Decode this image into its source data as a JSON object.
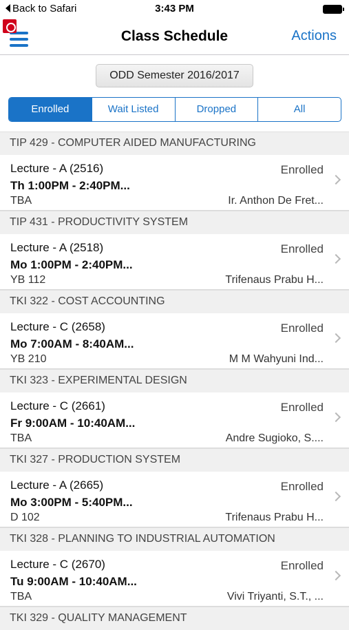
{
  "status_bar": {
    "back_label": "Back to Safari",
    "time": "3:43 PM"
  },
  "nav": {
    "title": "Class Schedule",
    "actions_label": "Actions"
  },
  "semester": {
    "label": "ODD Semester 2016/2017"
  },
  "tabs": [
    {
      "label": "Enrolled",
      "active": true
    },
    {
      "label": "Wait Listed",
      "active": false
    },
    {
      "label": "Dropped",
      "active": false
    },
    {
      "label": "All",
      "active": false
    }
  ],
  "courses": [
    {
      "header": "TIP 429 - COMPUTER AIDED MANUFACTURING",
      "section": "Lecture - A (2516)",
      "time": "Th 1:00PM - 2:40PM...",
      "room": "TBA",
      "status": "Enrolled",
      "instructor": "Ir. Anthon De Fret..."
    },
    {
      "header": "TIP 431 - PRODUCTIVITY SYSTEM",
      "section": "Lecture - A (2518)",
      "time": "Mo 1:00PM - 2:40PM...",
      "room": "YB 112",
      "status": "Enrolled",
      "instructor": "Trifenaus Prabu H..."
    },
    {
      "header": "TKI 322 - COST ACCOUNTING",
      "section": "Lecture - C (2658)",
      "time": "Mo 7:00AM - 8:40AM...",
      "room": "YB 210",
      "status": "Enrolled",
      "instructor": "M M Wahyuni Ind..."
    },
    {
      "header": "TKI 323 - EXPERIMENTAL DESIGN",
      "section": "Lecture - C (2661)",
      "time": "Fr 9:00AM - 10:40AM...",
      "room": "TBA",
      "status": "Enrolled",
      "instructor": "Andre Sugioko, S...."
    },
    {
      "header": "TKI 327 - PRODUCTION SYSTEM",
      "section": "Lecture - A (2665)",
      "time": "Mo 3:00PM - 5:40PM...",
      "room": "D 102",
      "status": "Enrolled",
      "instructor": "Trifenaus Prabu H..."
    },
    {
      "header": "TKI 328 - PLANNING TO INDUSTRIAL AUTOMATION",
      "section": "Lecture - C (2670)",
      "time": "Tu 9:00AM - 10:40AM...",
      "room": "TBA",
      "status": "Enrolled",
      "instructor": "Vivi Triyanti, S.T., ..."
    },
    {
      "header": "TKI 329 - QUALITY MANAGEMENT"
    }
  ],
  "icons": {
    "menu": "hamburger-icon",
    "app": "app-badge-icon",
    "row_disclosure": "chevron-right-icon"
  },
  "colors": {
    "accent": "#1a73c7"
  }
}
